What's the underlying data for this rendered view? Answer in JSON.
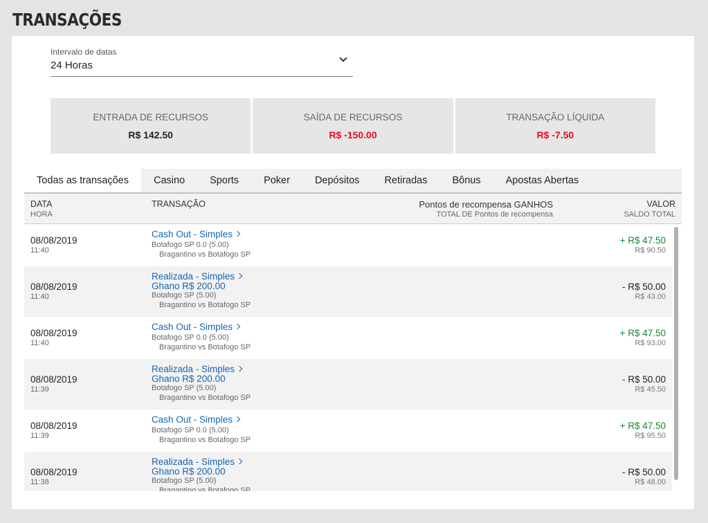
{
  "page": {
    "title": "TRANSAÇÕES"
  },
  "date_range": {
    "label": "Intervalo de datas",
    "value": "24 Horas"
  },
  "summary": [
    {
      "label": "ENTRADA DE RECURSOS",
      "value": "R$ 142.50",
      "color": "#222222"
    },
    {
      "label": "SAÍDA DE RECURSOS",
      "value": "R$ -150.00",
      "color": "#e0101b"
    },
    {
      "label": "TRANSAÇÃO LÍQUIDA",
      "value": "R$ -7.50",
      "color": "#e0101b"
    }
  ],
  "tabs": [
    "Todas as transações",
    "Casino",
    "Sports",
    "Poker",
    "Depósitos",
    "Retiradas",
    "Bônus",
    "Apostas Abertas"
  ],
  "active_tab": "Todas as transações",
  "table": {
    "headers": {
      "date": "DATA",
      "time": "HORA",
      "transaction": "TRANSAÇÃO",
      "points": "Pontos de recompensa GANHOS",
      "points_total": "TOTAL DE Pontos de recompensa",
      "value": "VALOR",
      "balance": "SALDO TOTAL"
    },
    "rows": [
      {
        "date": "08/08/2019",
        "time": "11:40",
        "title": "Cash Out - Simples",
        "subtitle": "",
        "selection": "Botafogo SP 0.0 (5.00)",
        "event": "Bragantino vs Botafogo SP",
        "amount": "+ R$ 47.50",
        "balance": "R$ 90.50",
        "positive": true
      },
      {
        "date": "08/08/2019",
        "time": "11:40",
        "title": "Realizada - Simples",
        "subtitle": "Ghano R$ 200.00",
        "selection": "Botafogo SP (5.00)",
        "event": "Bragantino vs Botafogo SP",
        "amount": "- R$ 50.00",
        "balance": "R$ 43.00",
        "positive": false
      },
      {
        "date": "08/08/2019",
        "time": "11:40",
        "title": "Cash Out - Simples",
        "subtitle": "",
        "selection": "Botafogo SP 0.0 (5.00)",
        "event": "Bragantino vs Botafogo SP",
        "amount": "+ R$ 47.50",
        "balance": "R$ 93.00",
        "positive": true
      },
      {
        "date": "08/08/2019",
        "time": "11:39",
        "title": "Realizada - Simples",
        "subtitle": "Ghano R$ 200.00",
        "selection": "Botafogo SP (5.00)",
        "event": "Bragantino vs Botafogo SP",
        "amount": "- R$ 50.00",
        "balance": "R$ 45.50",
        "positive": false
      },
      {
        "date": "08/08/2019",
        "time": "11:39",
        "title": "Cash Out - Simples",
        "subtitle": "",
        "selection": "Botafogo SP 0.0 (5.00)",
        "event": "Bragantino vs Botafogo SP",
        "amount": "+ R$ 47.50",
        "balance": "R$ 95.50",
        "positive": true
      },
      {
        "date": "08/08/2019",
        "time": "11:38",
        "title": "Realizada - Simples",
        "subtitle": "Ghano R$ 200.00",
        "selection": "Botafogo SP (5.00)",
        "event": "Bragantino vs Botafogo SP",
        "amount": "- R$ 50.00",
        "balance": "R$ 48.00",
        "positive": false
      }
    ]
  },
  "colors": {
    "positive": "#138a2c",
    "negative": "#e0101b",
    "link": "#1566b2"
  }
}
